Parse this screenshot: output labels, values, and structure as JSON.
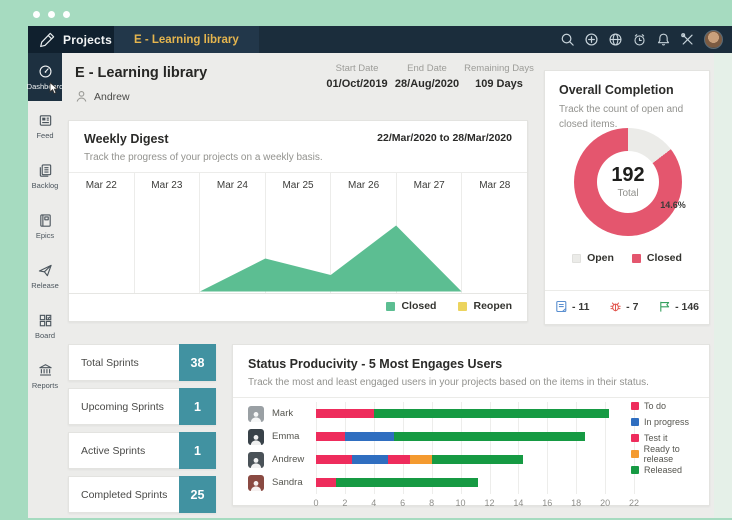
{
  "window": {
    "controls": "mac-dots"
  },
  "navbar": {
    "brand": "Projects",
    "tab": "E - Learning library",
    "icons": [
      "search-icon",
      "add-icon",
      "globe-icon",
      "alarm-icon",
      "bell-icon",
      "tools-icon",
      "user-avatar"
    ]
  },
  "sidebar": {
    "items": [
      {
        "label": "Dashboard",
        "active": true
      },
      {
        "label": "Feed",
        "active": false
      },
      {
        "label": "Backlog",
        "active": false
      },
      {
        "label": "Epics",
        "active": false
      },
      {
        "label": "Release",
        "active": false
      },
      {
        "label": "Board",
        "active": false
      },
      {
        "label": "Reports",
        "active": false
      }
    ]
  },
  "header": {
    "title": "E - Learning library",
    "owner": "Andrew",
    "meta": [
      {
        "label": "Start Date",
        "value": "01/Oct/2019"
      },
      {
        "label": "End Date",
        "value": "28/Aug/2020"
      },
      {
        "label": "Remaining Days",
        "value": "109 Days"
      }
    ]
  },
  "weekly": {
    "title": "Weekly Digest",
    "range": "22/Mar/2020 to 28/Mar/2020",
    "subtitle": "Track the progress of your projects on a weekly basis.",
    "legend": [
      {
        "label": "Closed",
        "color": "#5cbe92"
      },
      {
        "label": "Reopen",
        "color": "#ecd45e"
      }
    ]
  },
  "completion": {
    "title": "Overall Completion",
    "subtitle": "Track the count of open and closed items.",
    "total": "192",
    "total_label": "Total",
    "open_pct": "14.6%",
    "closed_pct": "85.4%",
    "legend": [
      {
        "label": "Open",
        "color": "#ebebe8"
      },
      {
        "label": "Closed",
        "color": "#e4566e"
      }
    ],
    "counters": [
      {
        "icon": "task-icon",
        "value": "- 11",
        "color": "#5a8fd0"
      },
      {
        "icon": "bug-icon",
        "value": "- 7",
        "color": "#e2574f"
      },
      {
        "icon": "milestone-flag-icon",
        "value": "- 146",
        "color": "#35a05e"
      }
    ]
  },
  "sprints": [
    {
      "label": "Total Sprints",
      "value": "38"
    },
    {
      "label": "Upcoming Sprints",
      "value": "1"
    },
    {
      "label": "Active Sprints",
      "value": "1"
    },
    {
      "label": "Completed Sprints",
      "value": "25"
    }
  ],
  "productivity": {
    "title": "Status Producivity - 5 Most Engages Users",
    "subtitle": "Track the most and least engaged users in your projects based on the items in their status.",
    "users": [
      {
        "name": "Mark",
        "avatar_color": "#9aa0a4"
      },
      {
        "name": "Emma",
        "avatar_color": "#394249"
      },
      {
        "name": "Andrew",
        "avatar_color": "#4a5258"
      },
      {
        "name": "Sandra",
        "avatar_color": "#8a4a42"
      }
    ],
    "legend": [
      {
        "label": "To do",
        "color": "#ee2c5c"
      },
      {
        "label": "In progress",
        "color": "#2f6ec0"
      },
      {
        "label": "Test it",
        "color": "#ee2c5c"
      },
      {
        "label": "Ready to release",
        "color": "#f49a2f"
      },
      {
        "label": "Released",
        "color": "#169a43"
      }
    ]
  },
  "chart_data": [
    {
      "type": "area",
      "title": "Weekly Digest",
      "x": [
        "Mar 22",
        "Mar 23",
        "Mar 24",
        "Mar 25",
        "Mar 26",
        "Mar 27",
        "Mar 28"
      ],
      "series": [
        {
          "name": "Closed",
          "color": "#5cbe92",
          "values": [
            0,
            0,
            0,
            2,
            1,
            4,
            0
          ]
        },
        {
          "name": "Reopen",
          "color": "#ecd45e",
          "values": [
            0,
            0,
            0,
            0,
            0,
            0,
            0
          ]
        }
      ],
      "ylim": [
        0,
        4.5
      ],
      "legend_position": "bottom-right",
      "grid": "vertical-day-separators"
    },
    {
      "type": "pie",
      "title": "Overall Completion",
      "donut": true,
      "center_total": 192,
      "center_label": "Total",
      "slices": [
        {
          "label": "Open",
          "pct": 14.6,
          "color": "#ebebe8"
        },
        {
          "label": "Closed",
          "pct": 85.4,
          "color": "#e4566e"
        }
      ],
      "legend_position": "bottom"
    },
    {
      "type": "bar",
      "orientation": "horizontal",
      "title": "Status Producivity - 5 Most Engages Users",
      "categories": [
        "Mark",
        "Emma",
        "Andrew",
        "Sandra"
      ],
      "series": [
        {
          "name": "To do",
          "color": "#ee2c5c",
          "values": [
            4,
            2,
            2.5,
            1.4
          ]
        },
        {
          "name": "In progress",
          "color": "#2f6ec0",
          "values": [
            0,
            3.4,
            2.5,
            0
          ]
        },
        {
          "name": "Test it",
          "color": "#ee2c5c",
          "values": [
            0,
            0,
            1.5,
            0
          ]
        },
        {
          "name": "Ready to release",
          "color": "#f49a2f",
          "values": [
            0,
            0,
            1.5,
            0
          ]
        },
        {
          "name": "Released",
          "color": "#169a43",
          "values": [
            16.3,
            13.2,
            6.3,
            9.8
          ]
        }
      ],
      "xlim": [
        0,
        22
      ],
      "xticks": [
        0,
        2,
        4,
        6,
        8,
        10,
        12,
        14,
        16,
        18,
        20,
        22
      ],
      "legend_position": "right",
      "grid": "vertical"
    }
  ]
}
